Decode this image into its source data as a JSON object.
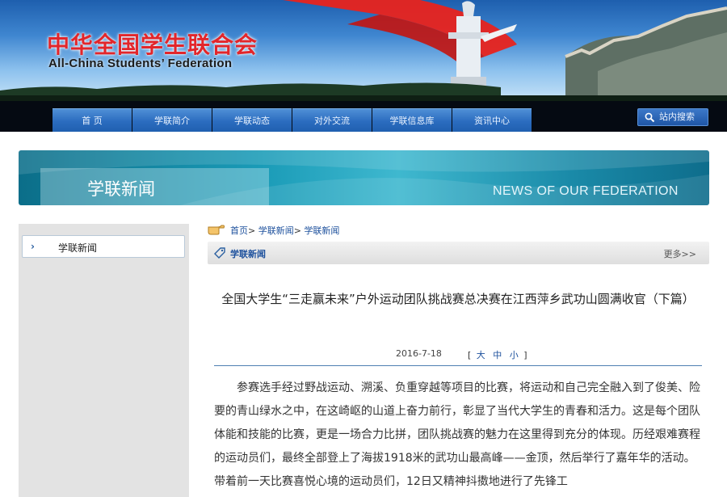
{
  "header": {
    "org_name_cn": "中华全国学生联合会",
    "org_name_en": "All-China Students’ Federation"
  },
  "nav": {
    "items": [
      {
        "label": "首 页"
      },
      {
        "label": "学联简介"
      },
      {
        "label": "学联动态"
      },
      {
        "label": "对外交流"
      },
      {
        "label": "学联信息库"
      },
      {
        "label": "资讯中心"
      }
    ],
    "search_label": "站内搜索"
  },
  "section": {
    "title_cn": "学联新闻",
    "title_en": "NEWS OF OUR FEDERATION"
  },
  "sidebar": {
    "items": [
      {
        "label": "学联新闻"
      }
    ]
  },
  "breadcrumb": {
    "home": "首页",
    "sep1": "> ",
    "level1": "学联新闻",
    "sep2": "> ",
    "level2": "学联新闻"
  },
  "column": {
    "name": "学联新闻",
    "more": "更多>>"
  },
  "article": {
    "title": "全国大学生“三走赢未来”户外运动团队挑战赛总决赛在江西萍乡武功山圆满收官（下篇）",
    "date": "2016-7-18",
    "size_open": "[",
    "size_large": "大",
    "size_medium": "中",
    "size_small": "小",
    "size_close": "]",
    "body": "参赛选手经过野战运动、溯溪、负重穿越等项目的比赛，将运动和自己完全融入到了俊美、险要的青山绿水之中，在这崎岖的山道上奋力前行，彰显了当代大学生的青春和活力。这是每个团队体能和技能的比赛，更是一场合力比拼，团队挑战赛的魅力在这里得到充分的体现。历经艰难赛程的运动员们，最终全部登上了海拔1918米的武功山最高峰——金顶，然后举行了嘉年华的活动。带着前一天比赛喜悦心境的运动员们，12日又精神抖擞地进行了先锋工"
  },
  "colors": {
    "nav_bg": "#050a12",
    "nav_tab": "#2b6cbf",
    "brand_red": "#e2262b",
    "link_blue": "#1b4f9c",
    "sidebar_bg": "#e3e3e3"
  }
}
